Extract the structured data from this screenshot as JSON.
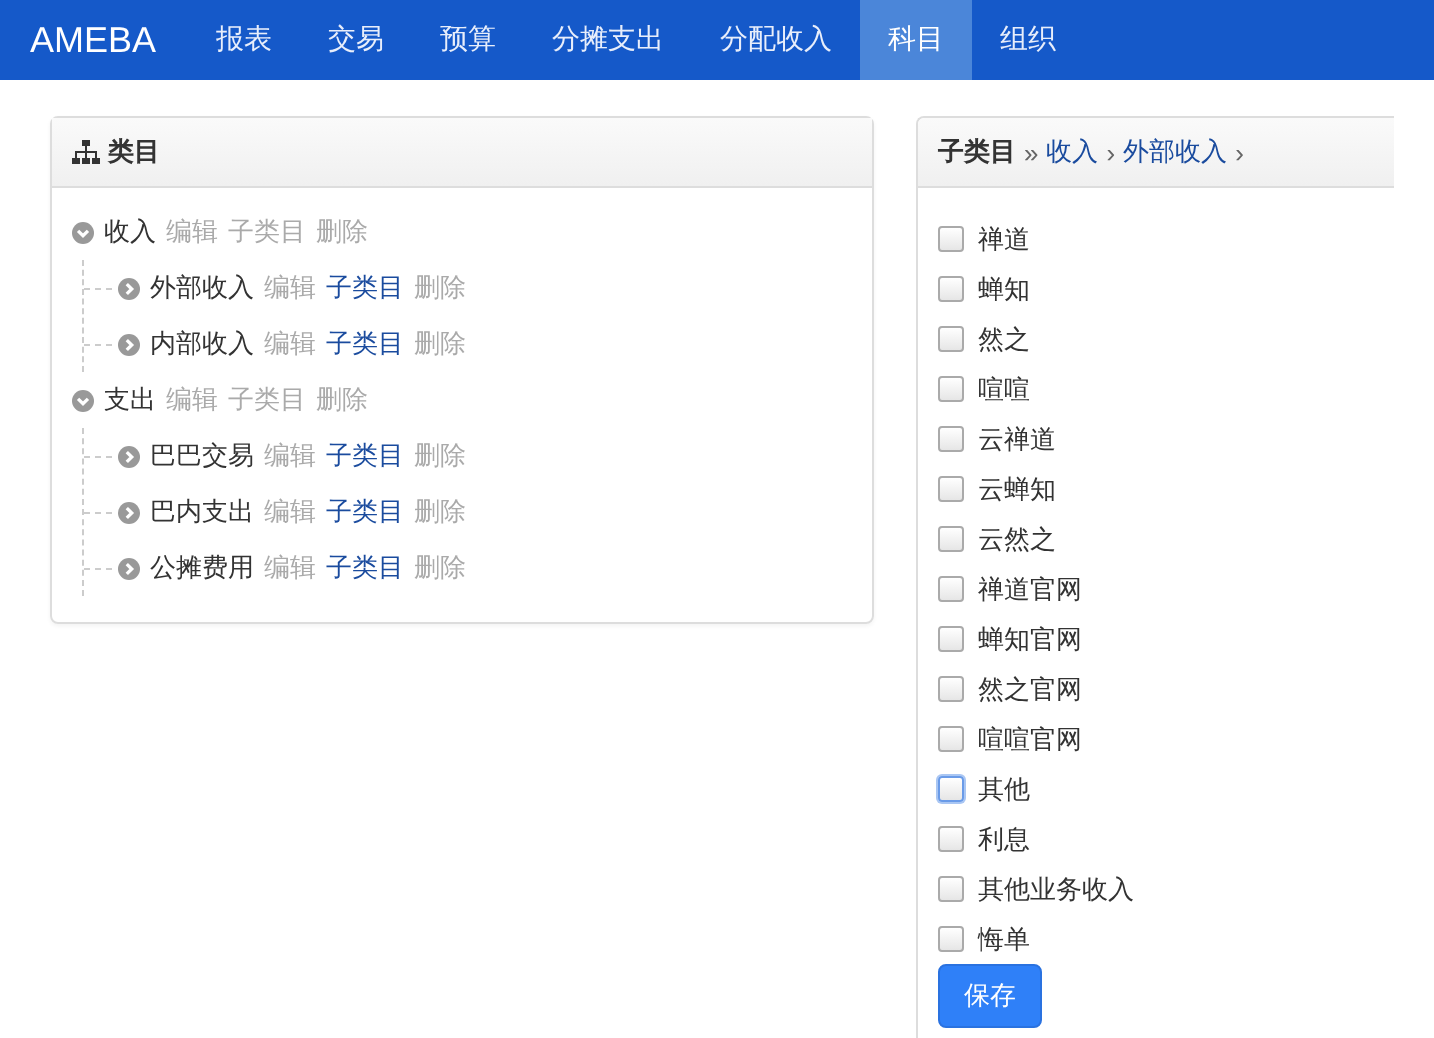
{
  "navbar": {
    "brand": "AMEBA",
    "items": [
      {
        "label": "报表",
        "selected": false
      },
      {
        "label": "交易",
        "selected": false
      },
      {
        "label": "预算",
        "selected": false
      },
      {
        "label": "分摊支出",
        "selected": false
      },
      {
        "label": "分配收入",
        "selected": false
      },
      {
        "label": "科目",
        "selected": true
      },
      {
        "label": "组织",
        "selected": false
      }
    ]
  },
  "category_panel": {
    "title": "类目",
    "tree": [
      {
        "label": "收入",
        "expanded": true,
        "actions": [
          {
            "label": "编辑",
            "active": false
          },
          {
            "label": "子类目",
            "active": false
          },
          {
            "label": "删除",
            "active": false
          }
        ],
        "children": [
          {
            "label": "外部收入",
            "expanded": false,
            "actions": [
              {
                "label": "编辑",
                "active": false
              },
              {
                "label": "子类目",
                "active": true
              },
              {
                "label": "删除",
                "active": false
              }
            ]
          },
          {
            "label": "内部收入",
            "expanded": false,
            "actions": [
              {
                "label": "编辑",
                "active": false
              },
              {
                "label": "子类目",
                "active": true
              },
              {
                "label": "删除",
                "active": false
              }
            ]
          }
        ]
      },
      {
        "label": "支出",
        "expanded": true,
        "actions": [
          {
            "label": "编辑",
            "active": false
          },
          {
            "label": "子类目",
            "active": false
          },
          {
            "label": "删除",
            "active": false
          }
        ],
        "children": [
          {
            "label": "巴巴交易",
            "expanded": false,
            "actions": [
              {
                "label": "编辑",
                "active": false
              },
              {
                "label": "子类目",
                "active": true
              },
              {
                "label": "删除",
                "active": false
              }
            ]
          },
          {
            "label": "巴内支出",
            "expanded": false,
            "actions": [
              {
                "label": "编辑",
                "active": false
              },
              {
                "label": "子类目",
                "active": true
              },
              {
                "label": "删除",
                "active": false
              }
            ]
          },
          {
            "label": "公摊费用",
            "expanded": false,
            "actions": [
              {
                "label": "编辑",
                "active": false
              },
              {
                "label": "子类目",
                "active": true
              },
              {
                "label": "删除",
                "active": false
              }
            ]
          }
        ]
      }
    ]
  },
  "subcategory_panel": {
    "title": "子类目",
    "separator": "»",
    "breadcrumb": [
      "收入",
      "外部收入"
    ],
    "breadcrumb_arrow": "›",
    "options": [
      {
        "label": "禅道",
        "checked": false,
        "focused": false
      },
      {
        "label": "蝉知",
        "checked": false,
        "focused": false
      },
      {
        "label": "然之",
        "checked": false,
        "focused": false
      },
      {
        "label": "喧喧",
        "checked": false,
        "focused": false
      },
      {
        "label": "云禅道",
        "checked": false,
        "focused": false
      },
      {
        "label": "云蝉知",
        "checked": false,
        "focused": false
      },
      {
        "label": "云然之",
        "checked": false,
        "focused": false
      },
      {
        "label": "禅道官网",
        "checked": false,
        "focused": false
      },
      {
        "label": "蝉知官网",
        "checked": false,
        "focused": false
      },
      {
        "label": "然之官网",
        "checked": false,
        "focused": false
      },
      {
        "label": "喧喧官网",
        "checked": false,
        "focused": false
      },
      {
        "label": "其他",
        "checked": false,
        "focused": true
      },
      {
        "label": "利息",
        "checked": false,
        "focused": false
      },
      {
        "label": "其他业务收入",
        "checked": false,
        "focused": false
      },
      {
        "label": "悔单",
        "checked": false,
        "focused": false
      }
    ],
    "save_button": "保存"
  }
}
